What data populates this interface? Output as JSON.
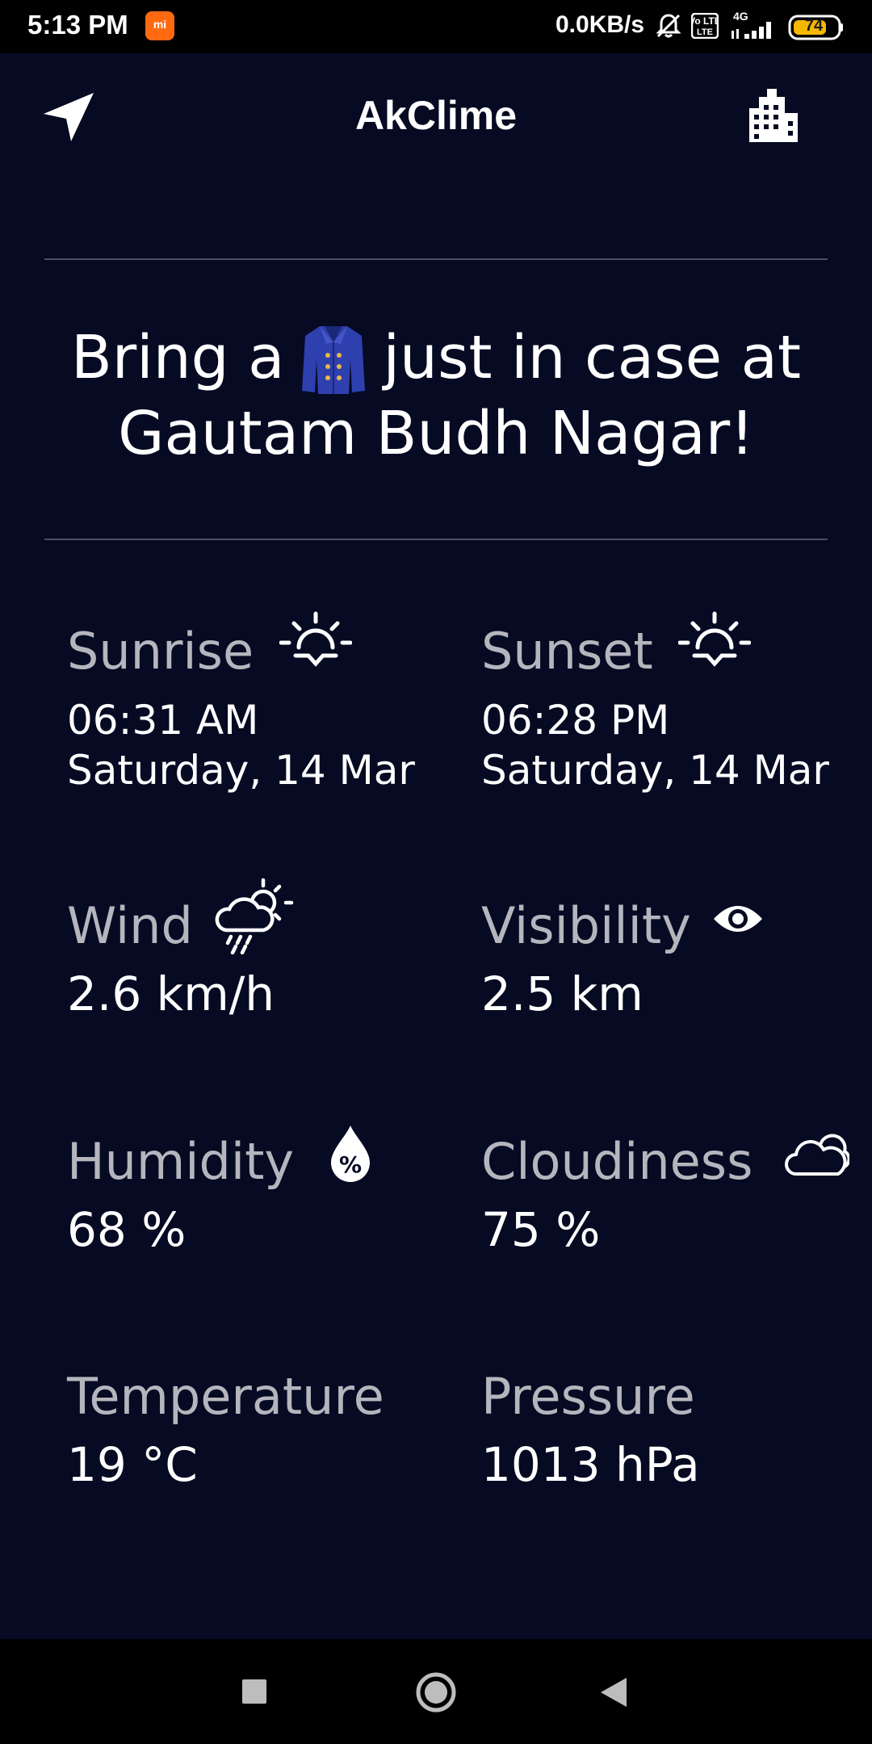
{
  "status_bar": {
    "time": "5:13 PM",
    "notif_app": "mi",
    "net_speed": "0.0KB/s",
    "volte": "Vo LTE",
    "network": "4G",
    "battery": "74",
    "icons": [
      "mute-icon",
      "volte-icon",
      "signal-icon",
      "battery-icon"
    ]
  },
  "app_bar": {
    "title": "AkClime",
    "left_icon": "navigation-arrow-icon",
    "right_icon": "city-buildings-icon"
  },
  "headline": {
    "prefix": "Bring a",
    "emoji_name": "coat-emoji",
    "suffix": "just in case at",
    "location": "Gautam Budh Nagar!"
  },
  "details": {
    "sunrise": {
      "label": "Sunrise",
      "time": "06:31 AM",
      "date": "Saturday, 14 Mar",
      "icon": "sunrise-icon"
    },
    "sunset": {
      "label": "Sunset",
      "time": "06:28 PM",
      "date": "Saturday, 14 Mar",
      "icon": "sunset-icon"
    },
    "wind": {
      "label": "Wind",
      "value": "2.6 km/h",
      "icon": "wind-weather-icon"
    },
    "visibility": {
      "label": "Visibility",
      "value": "2.5 km",
      "icon": "eye-icon"
    },
    "humidity": {
      "label": "Humidity",
      "value": "68 %",
      "icon": "humidity-drop-icon"
    },
    "cloudiness": {
      "label": "Cloudiness",
      "value": "75 %",
      "icon": "cloud-icon"
    },
    "temperature": {
      "label": "Temperature",
      "value": "19 °C"
    },
    "pressure": {
      "label": "Pressure",
      "value": "1013 hPa"
    }
  },
  "colors": {
    "background": "#060A22",
    "label": "#B5B5BD",
    "value": "#FFFFFF",
    "divider": "#4A4E66",
    "battery": "#F5B800"
  },
  "nav_bar": {
    "buttons": [
      "recents-square-icon",
      "home-circle-icon",
      "back-triangle-icon"
    ]
  }
}
